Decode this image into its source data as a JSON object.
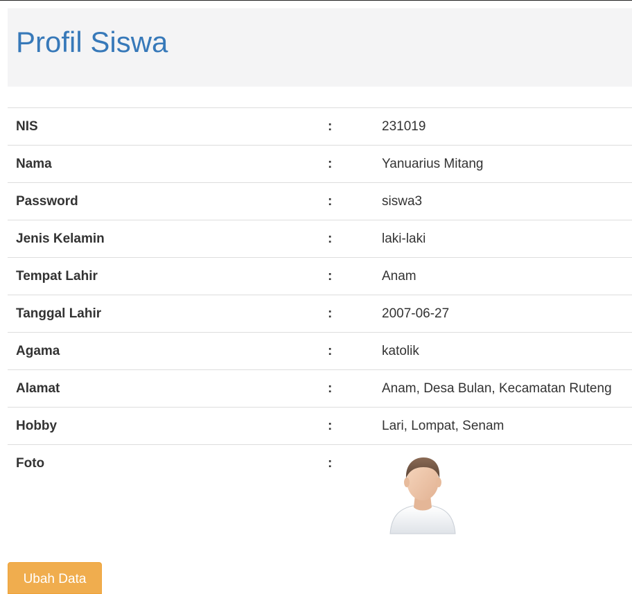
{
  "page": {
    "title": "Profil Siswa"
  },
  "profile": {
    "separator": ":",
    "rows": [
      {
        "label": "NIS",
        "value": "231019"
      },
      {
        "label": "Nama",
        "value": "Yanuarius Mitang"
      },
      {
        "label": "Password",
        "value": "siswa3"
      },
      {
        "label": "Jenis Kelamin",
        "value": "laki-laki"
      },
      {
        "label": "Tempat Lahir",
        "value": "Anam"
      },
      {
        "label": "Tanggal Lahir",
        "value": "2007-06-27"
      },
      {
        "label": "Agama",
        "value": "katolik"
      },
      {
        "label": "Alamat",
        "value": "Anam, Desa Bulan, Kecamatan Ruteng"
      },
      {
        "label": "Hobby",
        "value": "Lari, Lompat, Senam"
      }
    ],
    "photo_label": "Foto",
    "photo_icon": "user-avatar-icon"
  },
  "actions": {
    "edit_label": "Ubah Data"
  },
  "colors": {
    "title": "#3779b9",
    "jumbotron_bg": "#f4f4f5",
    "button_bg": "#f0ad4e",
    "row_border": "#dddddd"
  }
}
